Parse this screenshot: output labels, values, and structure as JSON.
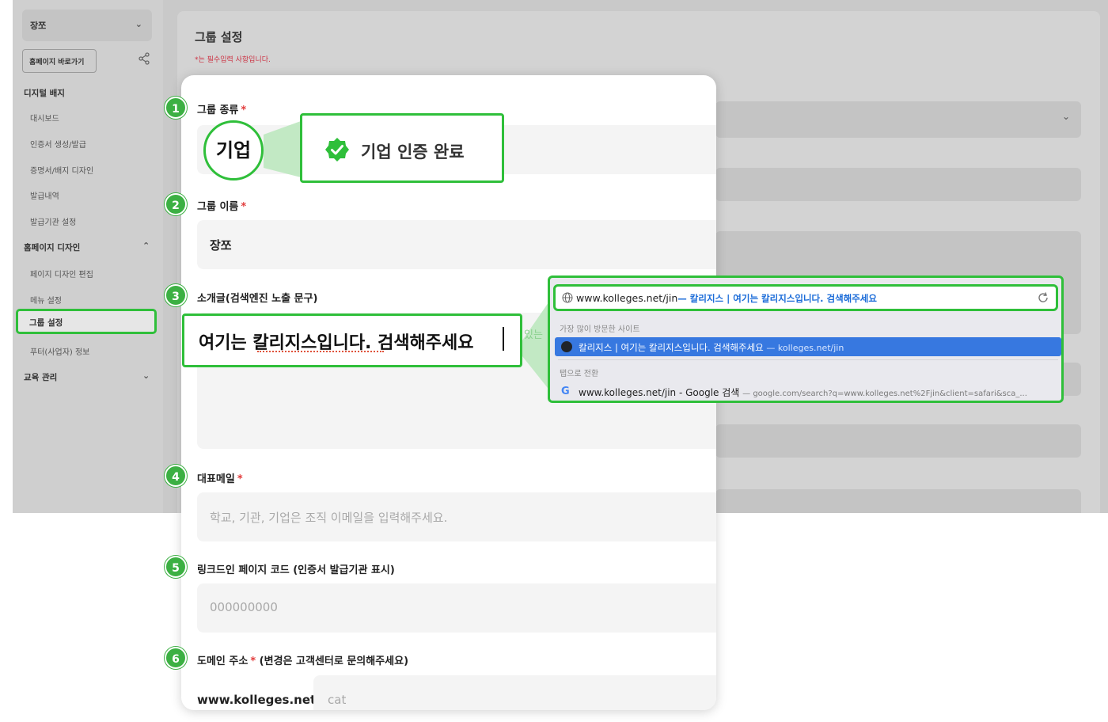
{
  "sidebar": {
    "org_select": "장쪼",
    "homepage_button": "홈페이지 바로가기",
    "sections": [
      {
        "label": "디지털 배지",
        "items": [
          "대시보드",
          "인증서 생성/발급",
          "증명서/배지 디자인",
          "발급내역",
          "발급기관 설정"
        ]
      },
      {
        "label": "홈페이지 디자인",
        "items": [
          "페이지 디자인 편집",
          "메뉴 설정",
          "그룹 설정",
          "푸터(사업자) 정보"
        ]
      },
      {
        "label": "교육 관리",
        "items": []
      }
    ],
    "active_item": "그룹 설정"
  },
  "page": {
    "title": "그룹 설정",
    "required_note": "*는 필수입력 사항입니다."
  },
  "form": {
    "group_type": {
      "label": "그룹 종류",
      "badge": "1",
      "bubble_value": "기업",
      "verified_text": "기업 인증 완료"
    },
    "group_name": {
      "label": "그룹 이름",
      "badge": "2",
      "value": "장쪼"
    },
    "intro": {
      "label": "소개글(검색엔진 노출 문구)",
      "badge": "3",
      "value": "여기는 칼리지스입니다. 검색해주세요",
      "hint_fragment": "있는"
    },
    "email": {
      "label": "대표메일",
      "badge": "4",
      "placeholder": "학교, 기관, 기업은 조직 이메일을 입력해주세요."
    },
    "linkedin": {
      "label": "링크드인 페이지 코드 (인증서 발급기관 표시)",
      "badge": "5",
      "placeholder": "000000000"
    },
    "domain": {
      "label": "도메인 주소",
      "note": "(변경은 고객센터로 문의해주세요)",
      "badge": "6",
      "prefix": "www.kolleges.net/",
      "placeholder": "cat"
    }
  },
  "browser_dropdown": {
    "address_typed": "www.kolleges.net/jin",
    "address_suggestion": "— 칼리지스 | 여기는 칼리지스입니다. 검색해주세요",
    "section_frequent": "가장 많이 방문한 사이트",
    "frequent_item_title": "칼리지스 | 여기는 칼리지스입니다. 검색해주세요",
    "frequent_item_url": "— kolleges.net/jin",
    "section_tab": "탭으로 전환",
    "google_item_title": "www.kolleges.net/jin - Google 검색",
    "google_item_url": "— google.com/search?q=www.kolleges.net%2Fjin&client=safari&sca_..."
  },
  "colors": {
    "accent_green": "#3cb043",
    "highlight_blue": "#3778e0",
    "required_red": "#e23b3b"
  }
}
